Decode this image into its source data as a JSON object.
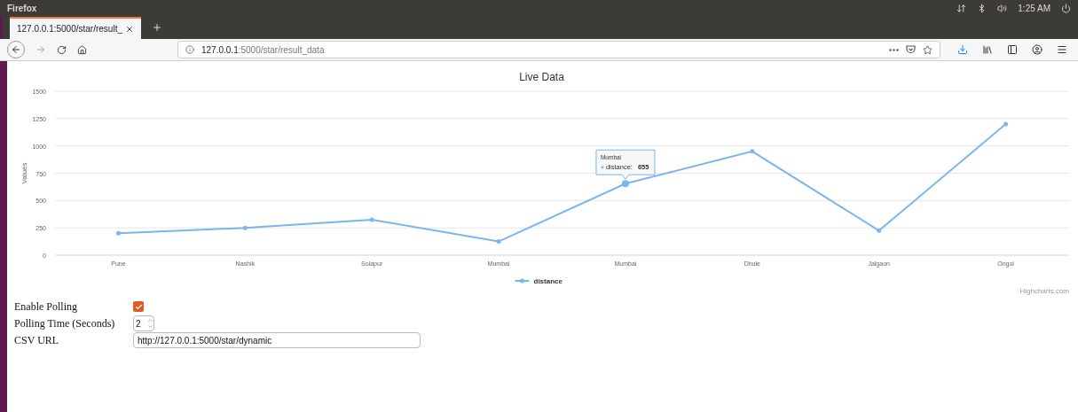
{
  "os_bar": {
    "app_name": "Firefox",
    "clock": "1:25 AM"
  },
  "tabs": [
    {
      "title": "127.0.0.1:5000/star/result_",
      "selected": true
    }
  ],
  "address_bar": {
    "host": "127.0.0.1",
    "path": ":5000/star/result_data"
  },
  "chart": {
    "chart_data": {
      "type": "line",
      "title": "Live Data",
      "ylabel": "Values",
      "categories": [
        "Pune",
        "Nashik",
        "Solapur",
        "Mumbai",
        "Mumbai",
        "Dhule",
        "Jalgaon",
        "Ongol"
      ],
      "series": [
        {
          "name": "distance",
          "color": "#7cb5ec",
          "values": [
            200,
            250,
            325,
            125,
            655,
            950,
            225,
            1200
          ]
        }
      ],
      "grid": true,
      "ylim": [
        0,
        1500
      ],
      "yticks": [
        0,
        250,
        500,
        750,
        1000,
        1250,
        1500
      ]
    },
    "tooltip": {
      "category": "Mumbai",
      "series": "distance:",
      "value": "655"
    },
    "credits": "Highcharts.com"
  },
  "form": {
    "enable_polling": {
      "label": "Enable Polling",
      "checked": true
    },
    "polling_time": {
      "label": "Polling Time (Seconds)",
      "value": "2"
    },
    "csv_url": {
      "label": "CSV URL",
      "value": "http://127.0.0.1:5000/star/dynamic"
    }
  }
}
